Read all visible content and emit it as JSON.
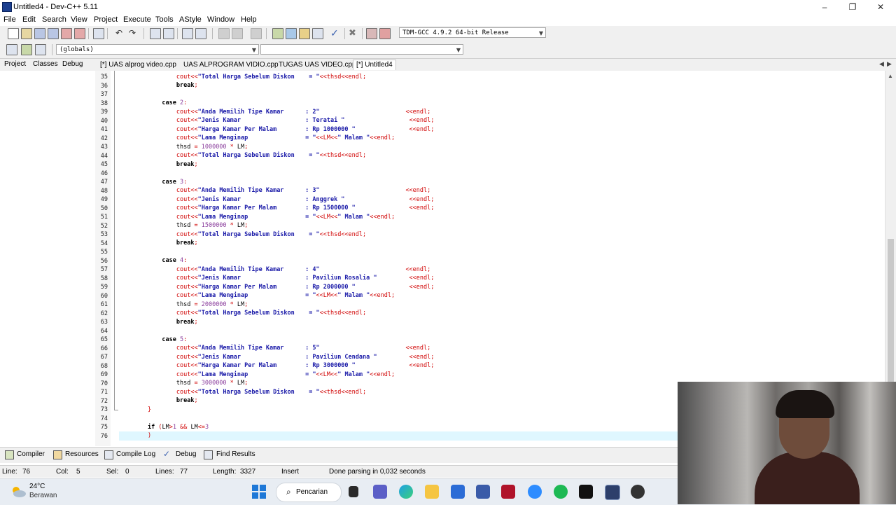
{
  "window": {
    "title": "Untitled4 - Dev-C++ 5.11"
  },
  "menu": [
    "File",
    "Edit",
    "Search",
    "View",
    "Project",
    "Execute",
    "Tools",
    "AStyle",
    "Window",
    "Help"
  ],
  "toolbar": {
    "compiler": "TDM-GCC 4.9.2 64-bit Release",
    "scope": "(globals)",
    "symbol": ""
  },
  "panel_tabs": [
    "Project",
    "Classes",
    "Debug"
  ],
  "file_tabs": [
    {
      "label": "[*] UAS alprog video.cpp",
      "active": false
    },
    {
      "label": "UAS ALPROGRAM VIDIO.cpp",
      "active": false
    },
    {
      "label": "TUGAS UAS VIDEO.cpp",
      "active": false
    },
    {
      "label": "[*] Untitled4",
      "active": true
    }
  ],
  "code_lines": [
    {
      "n": "35",
      "html": "                <span class=\"op\">cout&lt;&lt;</span><span class=\"st\">\"Total Harga Sebelum Diskon    = \"</span><span class=\"op\">&lt;&lt;thsd&lt;&lt;endl;</span>"
    },
    {
      "n": "36",
      "html": "                <span class=\"kw\">break</span><span class=\"op\">;</span>"
    },
    {
      "n": "37",
      "html": ""
    },
    {
      "n": "38",
      "html": "            <span class=\"kw\">case</span> <span class=\"nm\">2</span><span class=\"op\">:</span>"
    },
    {
      "n": "39",
      "html": "                <span class=\"op\">cout&lt;&lt;</span><span class=\"st\">\"Anda Memilih Tipe Kamar      : 2\"</span>                        <span class=\"op\">&lt;&lt;endl;</span>"
    },
    {
      "n": "40",
      "html": "                <span class=\"op\">cout&lt;&lt;</span><span class=\"st\">\"Jenis Kamar                  : Teratai \"</span>                  <span class=\"op\">&lt;&lt;endl;</span>"
    },
    {
      "n": "41",
      "html": "                <span class=\"op\">cout&lt;&lt;</span><span class=\"st\">\"Harga Kamar Per Malam        : Rp 1000000 \"</span>               <span class=\"op\">&lt;&lt;endl;</span>"
    },
    {
      "n": "42",
      "html": "                <span class=\"op\">cout&lt;&lt;</span><span class=\"st\">\"Lama Menginap                = \"</span><span class=\"op\">&lt;&lt;LM&lt;&lt;</span><span class=\"st\">\" Malam \"</span><span class=\"op\">&lt;&lt;endl;</span>"
    },
    {
      "n": "43",
      "html": "                thsd <span class=\"op\">=</span> <span class=\"nm\">1000000</span> <span class=\"op\">*</span> LM<span class=\"op\">;</span>"
    },
    {
      "n": "44",
      "html": "                <span class=\"op\">cout&lt;&lt;</span><span class=\"st\">\"Total Harga Sebelum Diskon    = \"</span><span class=\"op\">&lt;&lt;thsd&lt;&lt;endl;</span>"
    },
    {
      "n": "45",
      "html": "                <span class=\"kw\">break</span><span class=\"op\">;</span>"
    },
    {
      "n": "46",
      "html": ""
    },
    {
      "n": "47",
      "html": "            <span class=\"kw\">case</span> <span class=\"nm\">3</span><span class=\"op\">:</span>"
    },
    {
      "n": "48",
      "html": "                <span class=\"op\">cout&lt;&lt;</span><span class=\"st\">\"Anda Memilih Tipe Kamar      : 3\"</span>                        <span class=\"op\">&lt;&lt;endl;</span>"
    },
    {
      "n": "49",
      "html": "                <span class=\"op\">cout&lt;&lt;</span><span class=\"st\">\"Jenis Kamar                  : Anggrek \"</span>                  <span class=\"op\">&lt;&lt;endl;</span>"
    },
    {
      "n": "50",
      "html": "                <span class=\"op\">cout&lt;&lt;</span><span class=\"st\">\"Harga Kamar Per Malam        : Rp 1500000 \"</span>               <span class=\"op\">&lt;&lt;endl;</span>"
    },
    {
      "n": "51",
      "html": "                <span class=\"op\">cout&lt;&lt;</span><span class=\"st\">\"Lama Menginap                = \"</span><span class=\"op\">&lt;&lt;LM&lt;&lt;</span><span class=\"st\">\" Malam \"</span><span class=\"op\">&lt;&lt;endl;</span>"
    },
    {
      "n": "52",
      "html": "                thsd <span class=\"op\">=</span> <span class=\"nm\">1500000</span> <span class=\"op\">*</span> LM<span class=\"op\">;</span>"
    },
    {
      "n": "53",
      "html": "                <span class=\"op\">cout&lt;&lt;</span><span class=\"st\">\"Total Harga Sebelum Diskon    = \"</span><span class=\"op\">&lt;&lt;thsd&lt;&lt;endl;</span>"
    },
    {
      "n": "54",
      "html": "                <span class=\"kw\">break</span><span class=\"op\">;</span>"
    },
    {
      "n": "55",
      "html": ""
    },
    {
      "n": "56",
      "html": "            <span class=\"kw\">case</span> <span class=\"nm\">4</span><span class=\"op\">:</span>"
    },
    {
      "n": "57",
      "html": "                <span class=\"op\">cout&lt;&lt;</span><span class=\"st\">\"Anda Memilih Tipe Kamar      : 4\"</span>                        <span class=\"op\">&lt;&lt;endl;</span>"
    },
    {
      "n": "58",
      "html": "                <span class=\"op\">cout&lt;&lt;</span><span class=\"st\">\"Jenis Kamar                  : Paviliun Rosalia \"</span>         <span class=\"op\">&lt;&lt;endl;</span>"
    },
    {
      "n": "59",
      "html": "                <span class=\"op\">cout&lt;&lt;</span><span class=\"st\">\"Harga Kamar Per Malam        : Rp 2000000 \"</span>               <span class=\"op\">&lt;&lt;endl;</span>"
    },
    {
      "n": "60",
      "html": "                <span class=\"op\">cout&lt;&lt;</span><span class=\"st\">\"Lama Menginap                = \"</span><span class=\"op\">&lt;&lt;LM&lt;&lt;</span><span class=\"st\">\" Malam \"</span><span class=\"op\">&lt;&lt;endl;</span>"
    },
    {
      "n": "61",
      "html": "                thsd <span class=\"op\">=</span> <span class=\"nm\">2000000</span> <span class=\"op\">*</span> LM<span class=\"op\">;</span>"
    },
    {
      "n": "62",
      "html": "                <span class=\"op\">cout&lt;&lt;</span><span class=\"st\">\"Total Harga Sebelum Diskon    = \"</span><span class=\"op\">&lt;&lt;thsd&lt;&lt;endl;</span>"
    },
    {
      "n": "63",
      "html": "                <span class=\"kw\">break</span><span class=\"op\">;</span>"
    },
    {
      "n": "64",
      "html": ""
    },
    {
      "n": "65",
      "html": "            <span class=\"kw\">case</span> <span class=\"nm\">5</span><span class=\"op\">:</span>"
    },
    {
      "n": "66",
      "html": "                <span class=\"op\">cout&lt;&lt;</span><span class=\"st\">\"Anda Memilih Tipe Kamar      : 5\"</span>                        <span class=\"op\">&lt;&lt;endl;</span>"
    },
    {
      "n": "67",
      "html": "                <span class=\"op\">cout&lt;&lt;</span><span class=\"st\">\"Jenis Kamar                  : Paviliun Cendana \"</span>         <span class=\"op\">&lt;&lt;endl;</span>"
    },
    {
      "n": "68",
      "html": "                <span class=\"op\">cout&lt;&lt;</span><span class=\"st\">\"Harga Kamar Per Malam        : Rp 3000000 \"</span>               <span class=\"op\">&lt;&lt;endl;</span>"
    },
    {
      "n": "69",
      "html": "                <span class=\"op\">cout&lt;&lt;</span><span class=\"st\">\"Lama Menginap                = \"</span><span class=\"op\">&lt;&lt;LM&lt;&lt;</span><span class=\"st\">\" Malam \"</span><span class=\"op\">&lt;&lt;endl;</span>"
    },
    {
      "n": "70",
      "html": "                thsd <span class=\"op\">=</span> <span class=\"nm\">3000000</span> <span class=\"op\">*</span> LM<span class=\"op\">;</span>"
    },
    {
      "n": "71",
      "html": "                <span class=\"op\">cout&lt;&lt;</span><span class=\"st\">\"Total Harga Sebelum Diskon    = \"</span><span class=\"op\">&lt;&lt;thsd&lt;&lt;endl;</span>"
    },
    {
      "n": "72",
      "html": "                <span class=\"kw\">break</span><span class=\"op\">;</span>"
    },
    {
      "n": "73",
      "html": "        <span class=\"op\">}</span>"
    },
    {
      "n": "74",
      "html": ""
    },
    {
      "n": "75",
      "html": "        <span class=\"kw\">if</span> <span class=\"op\">(</span>LM<span class=\"op\">&gt;</span><span class=\"nm\">1</span> <span class=\"op\">&amp;&amp;</span> LM<span class=\"op\">&lt;=</span><span class=\"nm\">3</span>"
    },
    {
      "n": "76",
      "html": "        <span class=\"op\">)</span>"
    }
  ],
  "bottom_tabs": [
    "Compiler",
    "Resources",
    "Compile Log",
    "Debug",
    "Find Results"
  ],
  "status": {
    "line_label": "Line:",
    "line": "76",
    "col_label": "Col:",
    "col": "5",
    "sel_label": "Sel:",
    "sel": "0",
    "lines_label": "Lines:",
    "lines": "77",
    "length_label": "Length:",
    "length": "3327",
    "mode": "Insert",
    "message": "Done parsing in 0,032 seconds"
  },
  "taskbar": {
    "temperature": "24°C",
    "condition": "Berawan",
    "search_label": "Pencarian"
  }
}
